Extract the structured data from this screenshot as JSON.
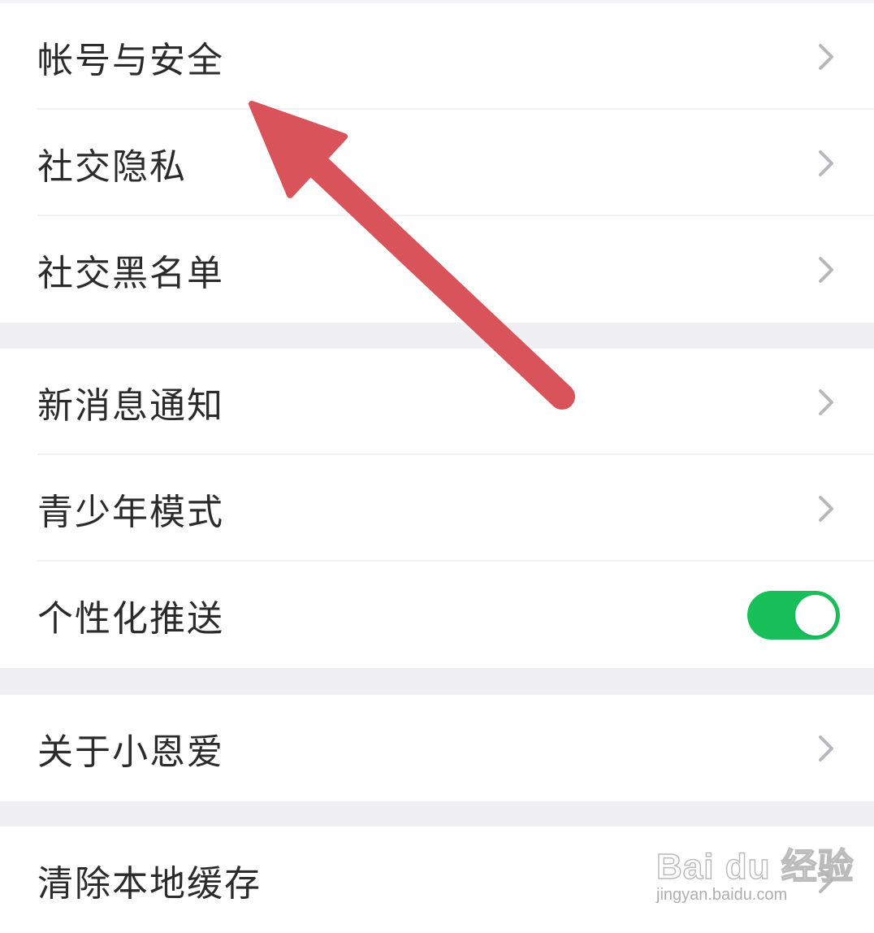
{
  "settings": {
    "group1": [
      {
        "label": "帐号与安全"
      },
      {
        "label": "社交隐私"
      },
      {
        "label": "社交黑名单"
      }
    ],
    "group2": [
      {
        "label": "新消息通知"
      },
      {
        "label": "青少年模式"
      },
      {
        "label": "个性化推送",
        "toggle_on": true
      }
    ],
    "group3": [
      {
        "label": "关于小恩爱"
      }
    ],
    "group4": [
      {
        "label": "清除本地缓存"
      }
    ]
  },
  "annotation": {
    "arrow_color": "#d9545a"
  },
  "watermark": {
    "logo": "Bai du 经验",
    "url": "jingyan.baidu.com"
  },
  "colors": {
    "toggle_on": "#19c05a",
    "background": "#efeff4",
    "text": "#2b2b2b",
    "chevron": "#b8b8bc"
  }
}
